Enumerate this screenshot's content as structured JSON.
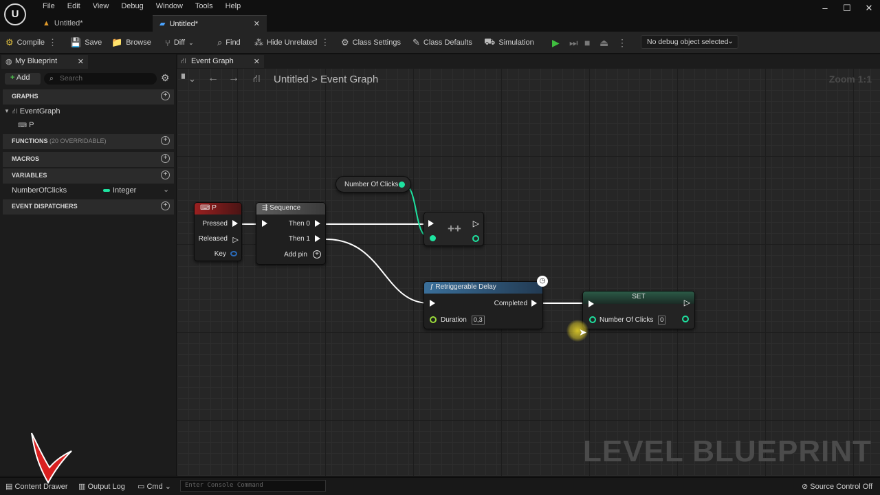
{
  "menu": [
    "File",
    "Edit",
    "View",
    "Debug",
    "Window",
    "Tools",
    "Help"
  ],
  "doc_tabs": [
    "Untitled*",
    "Untitled*"
  ],
  "toolbar": {
    "compile": "Compile",
    "save": "Save",
    "browse": "Browse",
    "diff": "Diff",
    "find": "Find",
    "hide_unrelated": "Hide Unrelated",
    "class_settings": "Class Settings",
    "class_defaults": "Class Defaults",
    "simulation": "Simulation",
    "debug_object": "No debug object selected"
  },
  "left_panel": {
    "tab": "My Blueprint",
    "add": "Add",
    "search_placeholder": "Search",
    "graphs_header": "GRAPHS",
    "event_graph": "EventGraph",
    "graph_child": "P",
    "functions_header": "FUNCTIONS",
    "functions_count": "(20 OVERRIDABLE)",
    "macros_header": "MACROS",
    "variables_header": "VARIABLES",
    "variable_name": "NumberOfClicks",
    "variable_type": "Integer",
    "dispatchers_header": "EVENT DISPATCHERS"
  },
  "graph": {
    "tab": "Event Graph",
    "breadcrumb_root": "Untitled",
    "breadcrumb_sep": ">",
    "breadcrumb_leaf": "Event Graph",
    "zoom": "Zoom 1:1",
    "watermark": "LEVEL BLUEPRINT"
  },
  "nodes": {
    "key_event": {
      "title": "P",
      "pressed": "Pressed",
      "released": "Released",
      "key": "Key"
    },
    "sequence": {
      "title": "Sequence",
      "then0": "Then 0",
      "then1": "Then 1",
      "add_pin": "Add pin"
    },
    "getter": {
      "title": "Number Of Clicks"
    },
    "increment": {
      "title": "++"
    },
    "delay": {
      "title": "Retriggerable Delay",
      "completed": "Completed",
      "duration": "Duration",
      "duration_value": "0,3"
    },
    "set": {
      "title": "SET",
      "var": "Number Of Clicks",
      "value": "0"
    }
  },
  "statusbar": {
    "content_drawer": "Content Drawer",
    "output_log": "Output Log",
    "cmd": "Cmd",
    "console_placeholder": "Enter Console Command",
    "source_control": "Source Control Off"
  },
  "colors": {
    "exec": "#ffffff",
    "integer_pin": "#1ee3a0",
    "key_pin": "#2a6ab8",
    "event_header": "#8a1f1f",
    "function_header": "#2f5a85",
    "set_header": "#1f4a3a",
    "play_green": "#3fbf3f"
  }
}
